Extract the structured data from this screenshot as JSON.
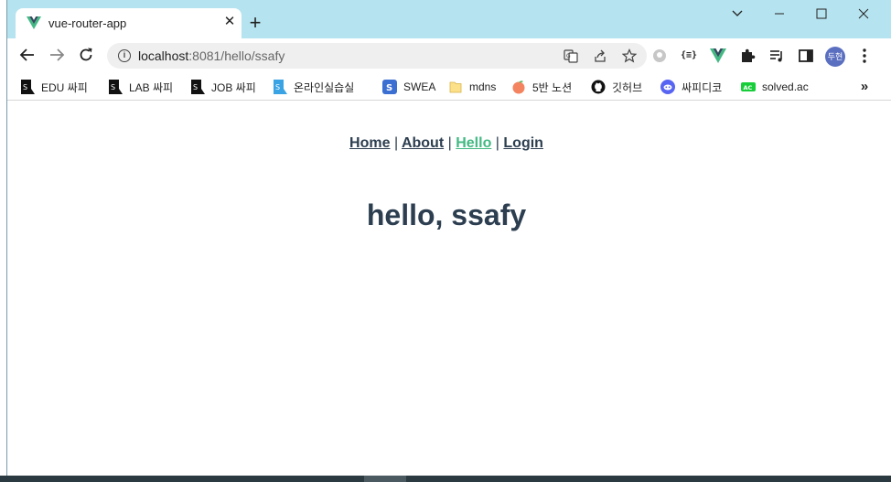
{
  "tab": {
    "title": "vue-router-app",
    "close_label": "✕"
  },
  "window_controls": {
    "chevron": "⌄",
    "minimize": "—",
    "maximize": "☐",
    "close": "✕"
  },
  "address_bar": {
    "host": "localhost",
    "path": ":8081/hello/ssafy"
  },
  "profile": {
    "initials": "두현"
  },
  "bookmarks": [
    {
      "label": "EDU 싸피",
      "icon": "ssafy-icon"
    },
    {
      "label": "LAB 싸피",
      "icon": "ssafy-icon"
    },
    {
      "label": "JOB 싸피",
      "icon": "ssafy-icon"
    },
    {
      "label": "온라인실습실",
      "icon": "ssafy-online-icon"
    },
    {
      "label": "SWEA",
      "icon": "swea-icon"
    },
    {
      "label": "mdns",
      "icon": "folder-icon"
    },
    {
      "label": "5반 노션",
      "icon": "peach-icon"
    },
    {
      "label": "깃허브",
      "icon": "github-icon"
    },
    {
      "label": "싸피디코",
      "icon": "discord-icon"
    },
    {
      "label": "solved.ac",
      "icon": "solvedac-icon"
    }
  ],
  "bookmarks_more": "»",
  "page": {
    "nav": [
      {
        "label": "Home",
        "active": false
      },
      {
        "label": "About",
        "active": false
      },
      {
        "label": "Hello",
        "active": true
      },
      {
        "label": "Login",
        "active": false
      }
    ],
    "separator": "|",
    "heading": "hello, ssafy"
  },
  "colors": {
    "vue_green": "#42b983",
    "text_dark": "#2c3e50",
    "titlebar": "#b5e3ef"
  }
}
